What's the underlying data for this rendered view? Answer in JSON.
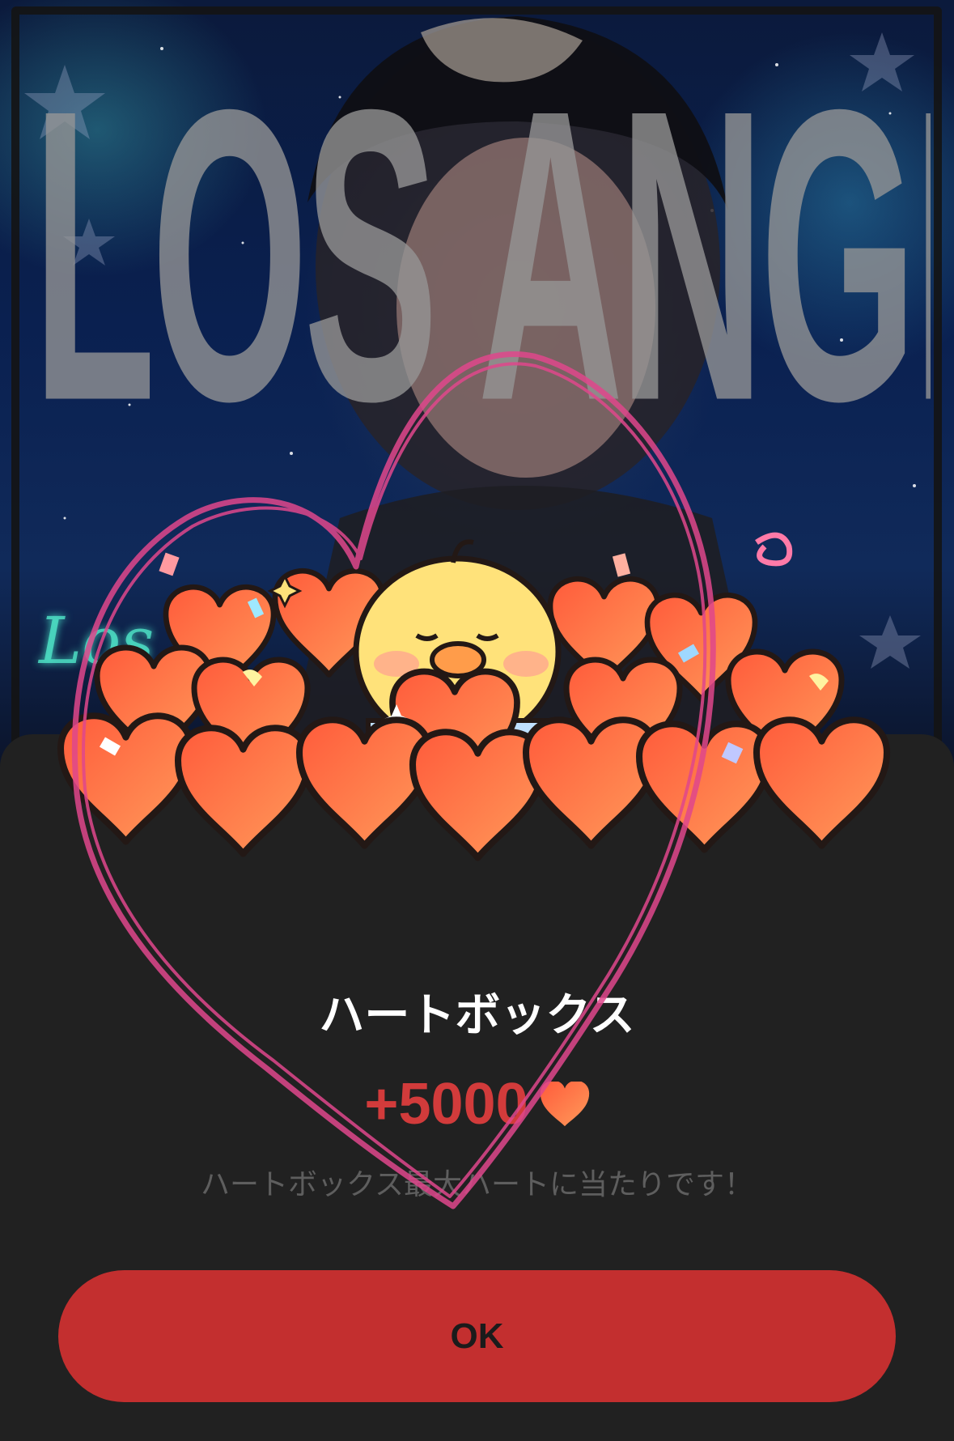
{
  "poster": {
    "big_text": "LOS ANGELES",
    "script_text": "Los"
  },
  "dialog": {
    "title": "ハートボックス",
    "reward_amount": "+5000",
    "reward_icon": "heart-icon",
    "message": "ハートボックス最大ハートに当たりです！",
    "ok_label": "OK"
  },
  "colors": {
    "sheet_background": "#212121",
    "accent_red": "#c32f2f",
    "reward_text": "#d23b3b",
    "message_text": "#5e5e5e",
    "scribble_pink": "#e0478c"
  },
  "illustration": {
    "character": "chick holding heart",
    "icon": "heart-box-illustration"
  }
}
